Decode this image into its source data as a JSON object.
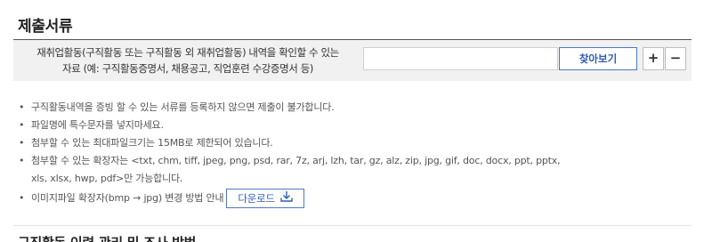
{
  "section": {
    "title": "제출서류"
  },
  "file_row": {
    "label_line1": "재취업활동(구직활동 또는 구직활동 외 재취업활동) 내역을 확인할 수 있는",
    "label_line2": "자료 (예: 구직활동증명서, 채용공고, 직업훈련 수강증명서 등)",
    "file_input_value": "",
    "browse_label": "찾아보기",
    "add_label": "+",
    "remove_label": "−"
  },
  "notices": [
    "구직활동내역을 증빙 할 수 있는 서류를 등록하지 않으면 제출이 불가합니다.",
    "파일명에 특수문자를 넣지마세요.",
    "첨부할 수 있는 최대파일크기는 15MB로 제한되어 있습니다.",
    "첨부할 수 있는 확장자는 <txt, chm, tiff, jpeg, png, psd, rar, 7z, arj, lzh, tar, gz, alz, zip, jpg, gif, doc, docx, ppt, pptx,",
    "xls, xlsx, hwp, pdf>만 가능합니다.",
    "이미지파일 확장자(bmp → jpg) 변경 방법 안내"
  ],
  "download": {
    "label": "다운로드",
    "icon": "download-icon"
  },
  "next_section": {
    "title": "구직활동 이력 관리 및 조사 방법"
  },
  "colors": {
    "accent": "#2f5eb4",
    "row_bg": "#f1f1f1",
    "top_rule": "#555555"
  }
}
